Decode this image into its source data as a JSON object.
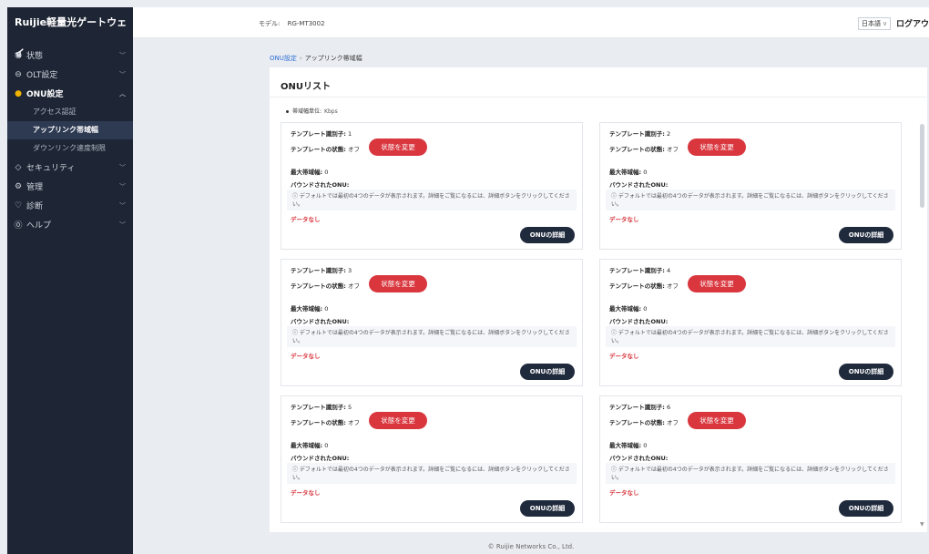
{
  "app": {
    "brand": "Ruijie軽量光ゲートウェイ"
  },
  "sidebar": {
    "items": [
      {
        "label": "状態",
        "icon": "status-icon",
        "glyph": "◉"
      },
      {
        "label": "OLT設定",
        "icon": "olt-icon",
        "glyph": "⊖"
      },
      {
        "label": "ONU設定",
        "icon": "onu-icon",
        "glyph": "●",
        "open": true,
        "sub": [
          {
            "label": "アクセス認証"
          },
          {
            "label": "アップリンク帯域幅",
            "active": true
          },
          {
            "label": "ダウンリンク速度制限"
          }
        ]
      },
      {
        "label": "セキュリティ",
        "icon": "shield-icon",
        "glyph": "◇"
      },
      {
        "label": "管理",
        "icon": "gear-icon",
        "glyph": "⚙"
      },
      {
        "label": "診断",
        "icon": "diagnose-icon",
        "glyph": "♡"
      },
      {
        "label": "ヘルプ",
        "icon": "help-icon",
        "glyph": "⓪"
      }
    ]
  },
  "header": {
    "model_label": "モデル:",
    "model_value": "RG-MT3002",
    "language": "日本語",
    "logout": "ログアウ"
  },
  "breadcrumb": {
    "parent": "ONU設定",
    "sep": "›",
    "current": "アップリンク帯域幅"
  },
  "panel": {
    "title": "ONUリスト",
    "unit_label": "帯域幅単位:",
    "unit_value": "Kbps"
  },
  "labels": {
    "template_id": "テンプレート識別子:",
    "template_status": "テンプレートの状態:",
    "status_value": "オフ",
    "change_status": "状態を変更",
    "max_bandwidth": "最大帯域幅:",
    "bound_onu": "バウンドされたONU:",
    "info": "ⓘ デフォルトでは最初の4つのデータが表示されます。詳細をご覧になるには、詳細ボタンをクリックしてください。",
    "no_data": "データなし",
    "onu_detail": "ONUの詳細"
  },
  "cards": [
    {
      "id": "1",
      "max_bw": "0"
    },
    {
      "id": "2",
      "max_bw": "0"
    },
    {
      "id": "3",
      "max_bw": "0"
    },
    {
      "id": "4",
      "max_bw": "0"
    },
    {
      "id": "5",
      "max_bw": "0"
    },
    {
      "id": "6",
      "max_bw": "0"
    }
  ],
  "footer": {
    "text": "© Ruijie Networks Co., Ltd."
  }
}
